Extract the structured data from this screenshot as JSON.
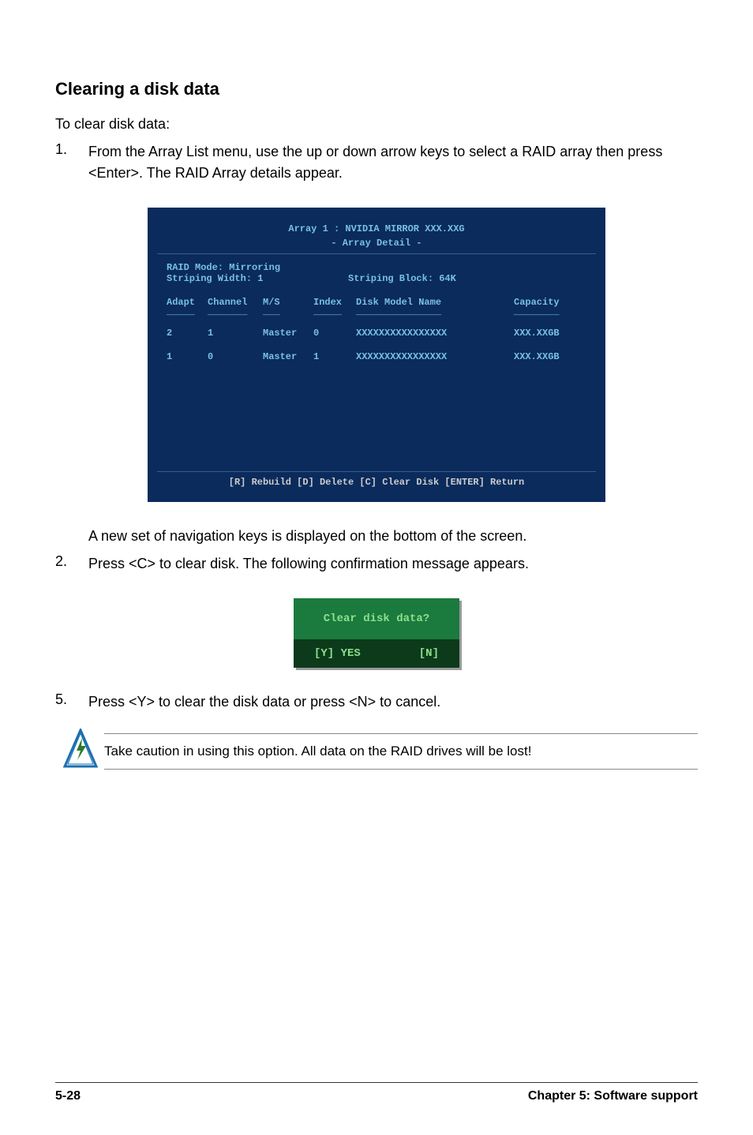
{
  "heading": "Clearing a disk data",
  "intro": "To clear disk data:",
  "step1_num": "1.",
  "step1_text": "From the Array List menu, use the up or down arrow keys to select a RAID array then press <Enter>. The RAID Array details appear.",
  "raid": {
    "title_line1": "Array 1 : NVIDIA MIRROR  XXX.XXG",
    "title_line2": "- Array Detail -",
    "mode_label": "RAID Mode: Mirroring",
    "width_label": "Striping Width: 1",
    "block_label": "Striping Block: 64K",
    "headers": {
      "adapt": "Adapt",
      "channel": "Channel",
      "ms": "M/S",
      "index": "Index",
      "model": "Disk Model Name",
      "capacity": "Capacity"
    },
    "rows": [
      {
        "adapt": "2",
        "channel": "1",
        "ms": "Master",
        "index": "0",
        "model": "XXXXXXXXXXXXXXXX",
        "cap": "XXX.XXGB"
      },
      {
        "adapt": "1",
        "channel": "0",
        "ms": "Master",
        "index": "1",
        "model": "XXXXXXXXXXXXXXXX",
        "cap": "XXX.XXGB"
      }
    ],
    "footer": "[R] Rebuild  [D] Delete  [C] Clear Disk  [ENTER] Return"
  },
  "below1": "A new set of  navigation keys is displayed on the bottom of the screen.",
  "step2_num": "2.",
  "step2_text": "Press <C> to clear disk. The following confirmation message appears.",
  "confirm": {
    "question": "Clear disk data?",
    "yes": "[Y] YES",
    "no": "[N]"
  },
  "step5_num": "5.",
  "step5_text": "Press <Y> to clear the disk data or press <N> to cancel.",
  "note_text": "Take caution in using this option. All data on the RAID drives will be lost!",
  "footer_left": "5-28",
  "footer_right": "Chapter 5: Software support"
}
